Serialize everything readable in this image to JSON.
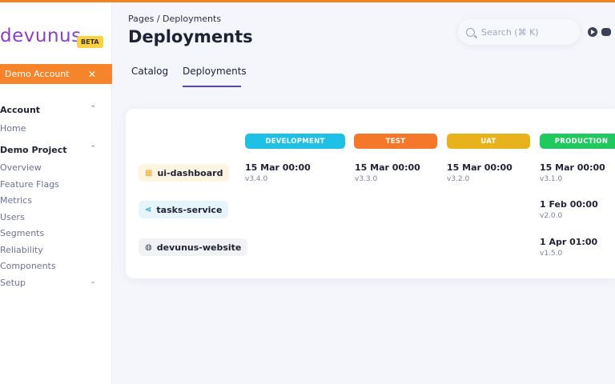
{
  "brand": {
    "name": "devunus",
    "badge": "BETA",
    "color": "#8b3fc9"
  },
  "account": {
    "label": "Demo Account",
    "close": "✕"
  },
  "sidebar": {
    "sections": [
      {
        "title": "Account",
        "items": [
          "Home"
        ]
      },
      {
        "title": "Demo Project",
        "items": [
          "Overview",
          "Feature Flags",
          "Metrics",
          "Users",
          "Segments",
          "Reliability",
          "Components"
        ]
      }
    ],
    "setup_label": "Setup"
  },
  "header": {
    "breadcrumb": "Pages  /  Deployments",
    "title": "Deployments",
    "search_placeholder": "Search (⌘ K)"
  },
  "tabs": [
    "Catalog",
    "Deployments"
  ],
  "active_tab": "Deployments",
  "environments": [
    {
      "name": "DEVELOPMENT",
      "color": "#1ec0e6"
    },
    {
      "name": "TEST",
      "color": "#f4772a"
    },
    {
      "name": "UAT",
      "color": "#e7b21c"
    },
    {
      "name": "PRODUCTION",
      "color": "#1fc95d"
    }
  ],
  "services": [
    {
      "name": "ui-dashboard",
      "icon": "grid-icon",
      "badge_bg": "#fdf4e2",
      "icon_color": "#f0a53a",
      "deployments": [
        {
          "time": "15 Mar 00:00",
          "version": "v3.4.0"
        },
        {
          "time": "15 Mar 00:00",
          "version": "v3.3.0"
        },
        {
          "time": "15 Mar 00:00",
          "version": "v3.2.0"
        },
        {
          "time": "15 Mar 00:00",
          "version": "v3.1.0"
        }
      ]
    },
    {
      "name": "tasks-service",
      "icon": "share-icon",
      "badge_bg": "#e6f5fb",
      "icon_color": "#2a9bd1",
      "deployments": [
        null,
        null,
        null,
        {
          "time": "1 Feb 00:00",
          "version": "v2.0.0"
        }
      ]
    },
    {
      "name": "devunus-website",
      "icon": "globe-icon",
      "badge_bg": "#f1f2f6",
      "icon_color": "#3b4056",
      "deployments": [
        null,
        null,
        null,
        {
          "time": "1 Apr 01:00",
          "version": "v1.5.0"
        }
      ]
    }
  ]
}
